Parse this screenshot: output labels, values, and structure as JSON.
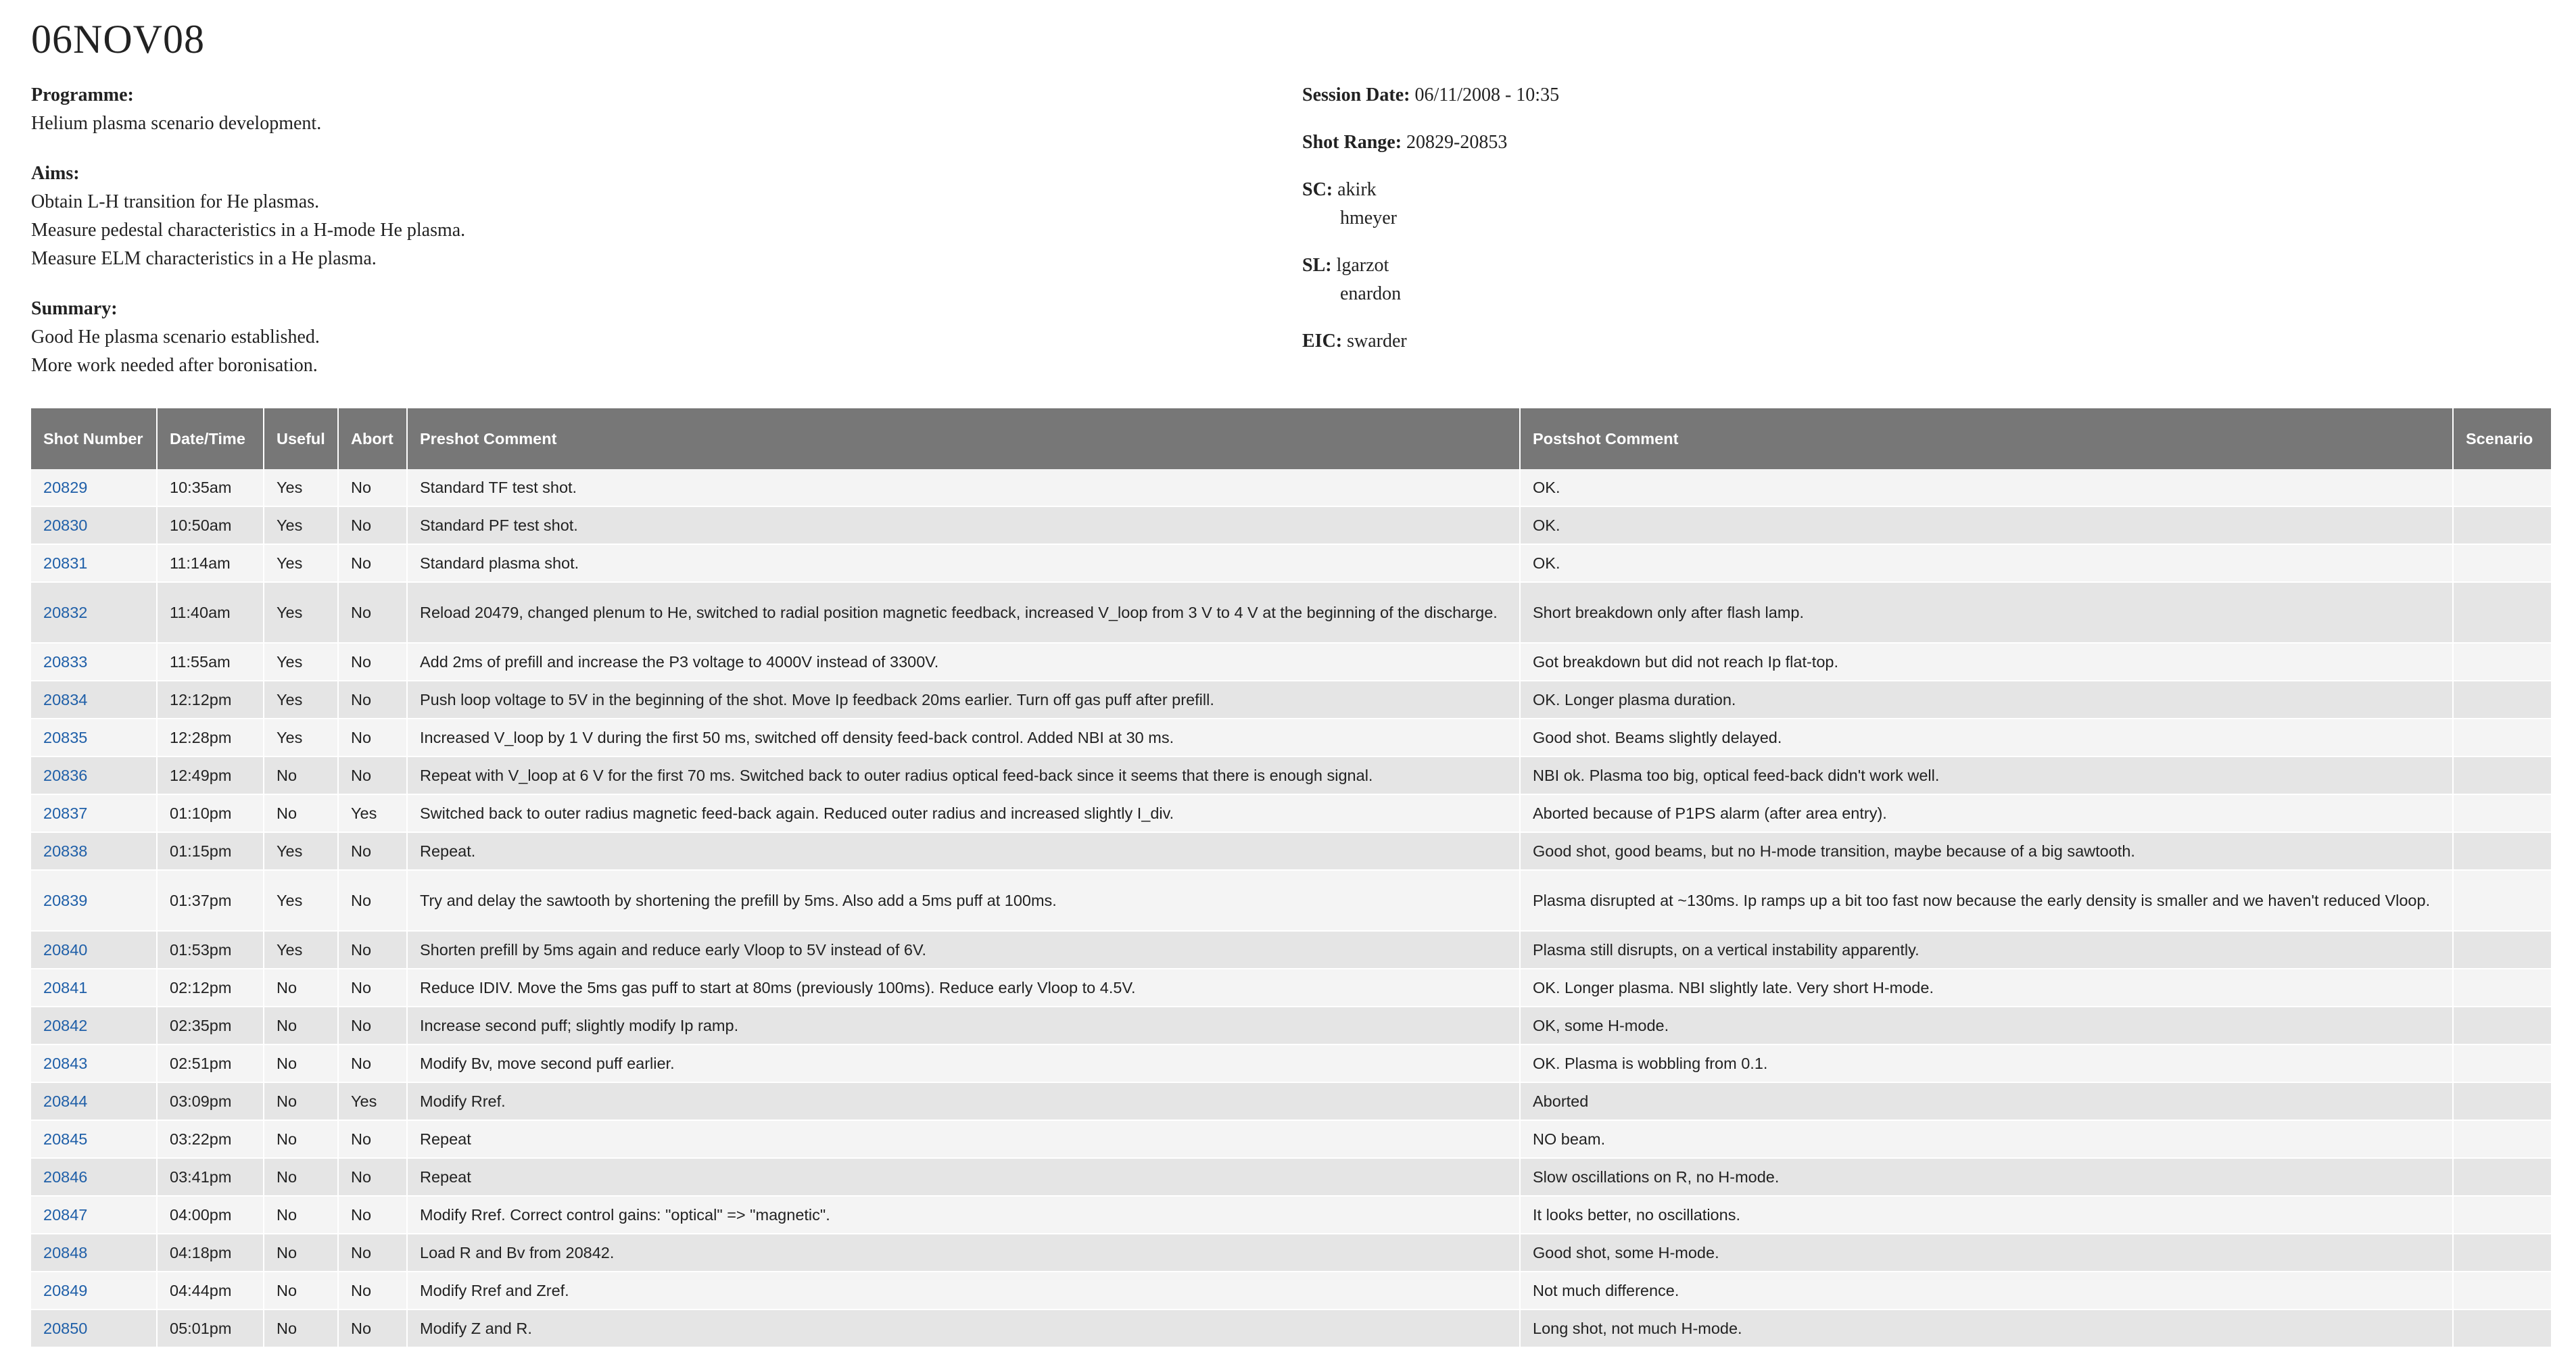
{
  "title": "06NOV08",
  "programme": {
    "label": "Programme:",
    "lines": [
      "Helium plasma scenario development."
    ]
  },
  "aims": {
    "label": "Aims:",
    "lines": [
      "Obtain L-H transition for He plasmas.",
      "Measure pedestal characteristics in a H-mode He plasma.",
      "Measure ELM characteristics in a He plasma."
    ]
  },
  "summary": {
    "label": "Summary:",
    "lines": [
      "Good He plasma scenario established.",
      "More work needed after boronisation."
    ]
  },
  "session_date": {
    "label": "Session Date:",
    "value": "06/11/2008 - 10:35"
  },
  "shot_range": {
    "label": "Shot Range:",
    "value": "20829-20853"
  },
  "sc": {
    "label": "SC:",
    "values": [
      "akirk",
      "hmeyer"
    ]
  },
  "sl": {
    "label": "SL:",
    "values": [
      "lgarzot",
      "enardon"
    ]
  },
  "eic": {
    "label": "EIC:",
    "value": "swarder"
  },
  "table": {
    "headers": {
      "shot_number": "Shot Number",
      "datetime": "Date/Time",
      "useful": "Useful",
      "abort": "Abort",
      "preshot": "Preshot Comment",
      "postshot": "Postshot Comment",
      "scenario": "Scenario"
    },
    "rows": [
      {
        "shot": "20829",
        "time": "10:35am",
        "useful": "Yes",
        "abort": "No",
        "preshot": "Standard TF test shot.",
        "postshot": "OK.",
        "scenario": ""
      },
      {
        "shot": "20830",
        "time": "10:50am",
        "useful": "Yes",
        "abort": "No",
        "preshot": "Standard PF test shot.",
        "postshot": "OK.",
        "scenario": ""
      },
      {
        "shot": "20831",
        "time": "11:14am",
        "useful": "Yes",
        "abort": "No",
        "preshot": "Standard plasma shot.",
        "postshot": "OK.",
        "scenario": ""
      },
      {
        "shot": "20832",
        "time": "11:40am",
        "useful": "Yes",
        "abort": "No",
        "preshot": "Reload 20479, changed plenum to He, switched to radial position magnetic feedback, increased V_loop from 3 V to 4 V at the beginning of the discharge.",
        "postshot": "Short breakdown only after flash lamp.",
        "scenario": ""
      },
      {
        "shot": "20833",
        "time": "11:55am",
        "useful": "Yes",
        "abort": "No",
        "preshot": "Add 2ms of prefill and increase the P3 voltage to 4000V instead of 3300V.",
        "postshot": "Got breakdown but did not reach Ip flat-top.",
        "scenario": ""
      },
      {
        "shot": "20834",
        "time": "12:12pm",
        "useful": "Yes",
        "abort": "No",
        "preshot": "Push loop voltage to 5V in the beginning of the shot. Move Ip feedback 20ms earlier. Turn off gas puff after prefill.",
        "postshot": "OK. Longer plasma duration.",
        "scenario": ""
      },
      {
        "shot": "20835",
        "time": "12:28pm",
        "useful": "Yes",
        "abort": "No",
        "preshot": "Increased V_loop by 1 V during the first 50 ms, switched off density feed-back control. Added NBI at 30 ms.",
        "postshot": "Good shot. Beams slightly delayed.",
        "scenario": ""
      },
      {
        "shot": "20836",
        "time": "12:49pm",
        "useful": "No",
        "abort": "No",
        "preshot": "Repeat with V_loop at 6 V for the first 70 ms. Switched back to outer radius optical feed-back since it seems that there is enough signal.",
        "postshot": "NBI ok. Plasma too big, optical feed-back didn't work well.",
        "scenario": ""
      },
      {
        "shot": "20837",
        "time": "01:10pm",
        "useful": "No",
        "abort": "Yes",
        "preshot": "Switched back to outer radius magnetic feed-back again. Reduced outer radius and increased slightly I_div.",
        "postshot": "Aborted because of P1PS alarm (after area entry).",
        "scenario": ""
      },
      {
        "shot": "20838",
        "time": "01:15pm",
        "useful": "Yes",
        "abort": "No",
        "preshot": "Repeat.",
        "postshot": "Good shot, good beams, but no H-mode transition, maybe because of a big sawtooth.",
        "scenario": ""
      },
      {
        "shot": "20839",
        "time": "01:37pm",
        "useful": "Yes",
        "abort": "No",
        "preshot": "Try and delay the sawtooth by shortening the prefill by 5ms. Also add a 5ms puff at 100ms.",
        "postshot": "Plasma disrupted at ~130ms. Ip ramps up a bit too fast now because the early density is smaller and we haven't reduced Vloop.",
        "scenario": ""
      },
      {
        "shot": "20840",
        "time": "01:53pm",
        "useful": "Yes",
        "abort": "No",
        "preshot": "Shorten prefill by 5ms again and reduce early Vloop to 5V instead of 6V.",
        "postshot": "Plasma still disrupts, on a vertical instability apparently.",
        "scenario": ""
      },
      {
        "shot": "20841",
        "time": "02:12pm",
        "useful": "No",
        "abort": "No",
        "preshot": "Reduce IDIV. Move the 5ms gas puff to start at 80ms (previously 100ms). Reduce early Vloop to 4.5V.",
        "postshot": "OK. Longer plasma. NBI slightly late. Very short H-mode.",
        "scenario": ""
      },
      {
        "shot": "20842",
        "time": "02:35pm",
        "useful": "No",
        "abort": "No",
        "preshot": "Increase second puff; slightly modify Ip ramp.",
        "postshot": "OK, some H-mode.",
        "scenario": ""
      },
      {
        "shot": "20843",
        "time": "02:51pm",
        "useful": "No",
        "abort": "No",
        "preshot": "Modify Bv, move second puff earlier.",
        "postshot": "OK. Plasma is wobbling from 0.1.",
        "scenario": ""
      },
      {
        "shot": "20844",
        "time": "03:09pm",
        "useful": "No",
        "abort": "Yes",
        "preshot": "Modify Rref.",
        "postshot": "Aborted",
        "scenario": ""
      },
      {
        "shot": "20845",
        "time": "03:22pm",
        "useful": "No",
        "abort": "No",
        "preshot": "Repeat",
        "postshot": "NO beam.",
        "scenario": ""
      },
      {
        "shot": "20846",
        "time": "03:41pm",
        "useful": "No",
        "abort": "No",
        "preshot": "Repeat",
        "postshot": "Slow oscillations on R, no H-mode.",
        "scenario": ""
      },
      {
        "shot": "20847",
        "time": "04:00pm",
        "useful": "No",
        "abort": "No",
        "preshot": "Modify Rref. Correct control gains: \"optical\" => \"magnetic\".",
        "postshot": "It looks better, no oscillations.",
        "scenario": ""
      },
      {
        "shot": "20848",
        "time": "04:18pm",
        "useful": "No",
        "abort": "No",
        "preshot": "Load R and Bv from 20842.",
        "postshot": "Good shot, some H-mode.",
        "scenario": ""
      },
      {
        "shot": "20849",
        "time": "04:44pm",
        "useful": "No",
        "abort": "No",
        "preshot": "Modify Rref and Zref.",
        "postshot": "Not much difference.",
        "scenario": ""
      },
      {
        "shot": "20850",
        "time": "05:01pm",
        "useful": "No",
        "abort": "No",
        "preshot": "Modify Z and R.",
        "postshot": "Long shot, not much H-mode.",
        "scenario": ""
      }
    ]
  },
  "colors": {
    "header_bg": "#777777",
    "row_light": "#f4f4f4",
    "row_dark": "#e5e5e5",
    "link": "#1f5fa8"
  }
}
